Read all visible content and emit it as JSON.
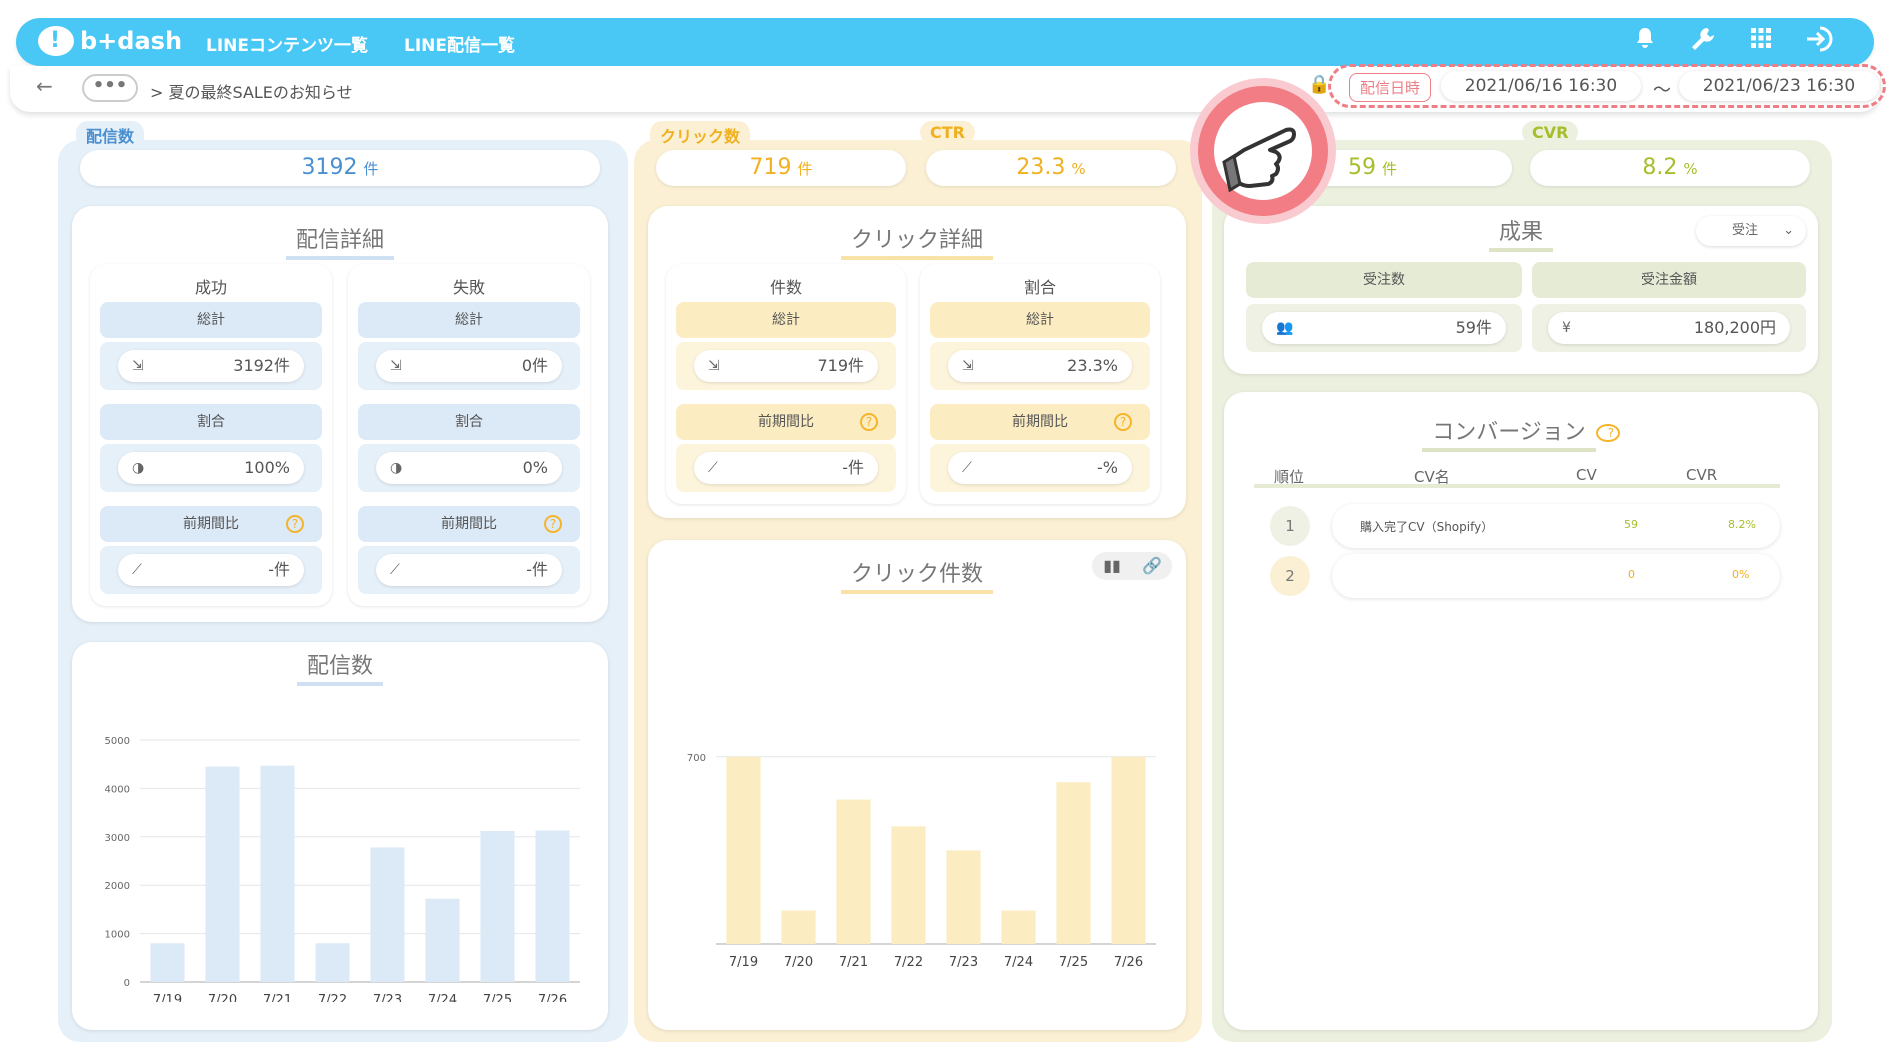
{
  "header": {
    "logo": "b+dash",
    "nav": [
      "LINEコンテンツ一覧",
      "LINE配信一覧"
    ],
    "icons": [
      "bell-icon",
      "wrench-icon",
      "grid-icon",
      "logout-icon"
    ]
  },
  "subbar": {
    "back": "←",
    "more": "•••",
    "breadcrumb": "> 夏の最終SALEのお知らせ",
    "date_label": "配信日時",
    "date_start": "2021/06/16 16:30",
    "date_sep": "〜",
    "date_end": "2021/06/23 16:30"
  },
  "kpi": {
    "delivery_tag": "配信数",
    "delivery_value": "3192",
    "delivery_unit": "件",
    "click_tag": "クリック数",
    "click_value": "719",
    "click_unit": "件",
    "ctr_tag": "CTR",
    "ctr_value": "23.3",
    "ctr_unit": "%",
    "cv_value": "59",
    "cv_unit": "件",
    "cvr_tag": "CVR",
    "cvr_value": "8.2",
    "cvr_unit": "%"
  },
  "delivery_detail": {
    "title": "配信詳細",
    "success": {
      "head": "成功",
      "total_label": "総計",
      "total": "3192件",
      "ratio_label": "割合",
      "ratio": "100%",
      "prev_label": "前期間比",
      "prev": "-件"
    },
    "fail": {
      "head": "失敗",
      "total_label": "総計",
      "total": "0件",
      "ratio_label": "割合",
      "ratio": "0%",
      "prev_label": "前期間比",
      "prev": "-件"
    }
  },
  "click_detail": {
    "title": "クリック詳細",
    "count": {
      "head": "件数",
      "total_label": "総計",
      "total": "719件",
      "prev_label": "前期間比",
      "prev": "-件"
    },
    "ratio": {
      "head": "割合",
      "total_label": "総計",
      "total": "23.3%",
      "prev_label": "前期間比",
      "prev": "-%"
    }
  },
  "result": {
    "title": "成果",
    "select": "受注",
    "orders_label": "受注数",
    "orders": "59件",
    "amount_label": "受注金額",
    "amount": "180,200円"
  },
  "conversion": {
    "title": "コンバージョン",
    "columns": [
      "順位",
      "CV名",
      "CV",
      "CVR"
    ],
    "rows": [
      {
        "rank": "1",
        "name": "購入完了CV（Shopify）",
        "cv": "59",
        "cvr": "8.2%"
      },
      {
        "rank": "2",
        "name": "",
        "cv": "0",
        "cvr": "0%"
      }
    ]
  },
  "delivery_chart": {
    "title": "配信数",
    "colors": {
      "bar": "#dce9f6"
    }
  },
  "click_chart": {
    "title": "クリック件数",
    "colors": {
      "bar": "#fbecc2"
    }
  },
  "chart_data": [
    {
      "type": "bar",
      "title": "配信数",
      "categories": [
        "7/19",
        "7/20",
        "7/21",
        "7/22",
        "7/23",
        "7/24",
        "7/25",
        "7/26"
      ],
      "values": [
        800,
        4450,
        4470,
        800,
        2780,
        1720,
        3120,
        3130
      ],
      "yticks": [
        0,
        1000,
        2000,
        3000,
        4000,
        5000
      ],
      "ylim": [
        0,
        5000
      ],
      "grid": true
    },
    {
      "type": "bar",
      "title": "クリック件数",
      "categories": [
        "7/19",
        "7/20",
        "7/21",
        "7/22",
        "7/23",
        "7/24",
        "7/25",
        "7/26"
      ],
      "values": [
        700,
        125,
        540,
        440,
        350,
        125,
        605,
        700
      ],
      "yticks": [
        700
      ],
      "ylim": [
        0,
        860
      ],
      "grid": true
    }
  ]
}
